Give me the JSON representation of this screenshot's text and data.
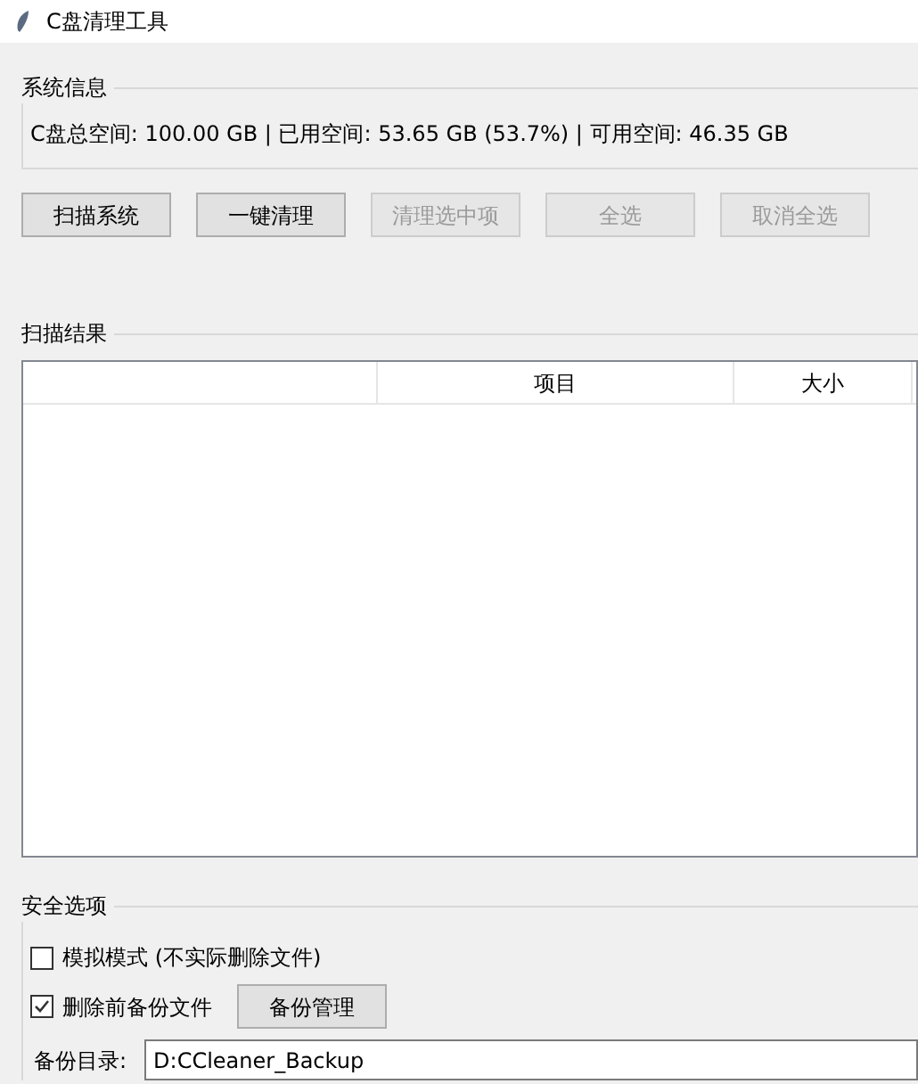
{
  "window": {
    "title": "C盘清理工具"
  },
  "system_info": {
    "title": "系统信息",
    "summary": "C盘总空间: 100.00 GB | 已用空间: 53.65 GB (53.7%) | 可用空间: 46.35 GB"
  },
  "buttons": [
    {
      "label": "扫描系统",
      "disabled": false
    },
    {
      "label": "一键清理",
      "disabled": false
    },
    {
      "label": "清理选中项",
      "disabled": true
    },
    {
      "label": "全选",
      "disabled": true
    },
    {
      "label": "取消全选",
      "disabled": true
    }
  ],
  "scan_results": {
    "title": "扫描结果",
    "columns": [
      "项目",
      "大小"
    ]
  },
  "safety": {
    "title": "安全选项",
    "options": [
      {
        "label": "模拟模式 (不实际删除文件)",
        "checked": false
      },
      {
        "label": "删除前备份文件",
        "checked": true
      }
    ],
    "backup_button": "备份管理",
    "backup_dir_label": "备份目录:",
    "backup_dir_value": "D:CCleaner_Backup"
  }
}
